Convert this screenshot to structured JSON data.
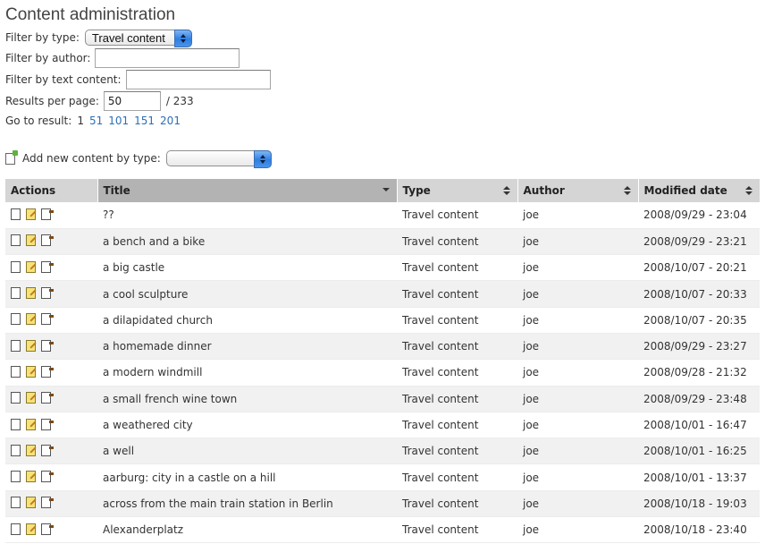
{
  "page": {
    "title": "Content administration"
  },
  "filters": {
    "type_label": "Filter by type:",
    "type_value": "Travel content",
    "author_label": "Filter by author:",
    "author_value": "",
    "text_label": "Filter by text content:",
    "text_value": ""
  },
  "results": {
    "per_page_label": "Results per page:",
    "per_page_value": "50",
    "total_text": "/ 233",
    "goto_label": "Go to result:",
    "current_page": "1",
    "pages": [
      "51",
      "101",
      "151",
      "201"
    ]
  },
  "add_new": {
    "label": "Add new content by type:",
    "value": ""
  },
  "table": {
    "headers": [
      "Actions",
      "Title",
      "Type",
      "Author",
      "Modified date"
    ],
    "rows": [
      {
        "title": "??",
        "type": "Travel content",
        "author": "joe",
        "date": "2008/09/29 - 23:04"
      },
      {
        "title": "a bench and a bike",
        "type": "Travel content",
        "author": "joe",
        "date": "2008/09/29 - 23:21"
      },
      {
        "title": "a big castle",
        "type": "Travel content",
        "author": "joe",
        "date": "2008/10/07 - 20:21"
      },
      {
        "title": "a cool sculpture",
        "type": "Travel content",
        "author": "joe",
        "date": "2008/10/07 - 20:33"
      },
      {
        "title": "a dilapidated church",
        "type": "Travel content",
        "author": "joe",
        "date": "2008/10/07 - 20:35"
      },
      {
        "title": "a homemade dinner",
        "type": "Travel content",
        "author": "joe",
        "date": "2008/09/29 - 23:27"
      },
      {
        "title": "a modern windmill",
        "type": "Travel content",
        "author": "joe",
        "date": "2008/09/28 - 21:32"
      },
      {
        "title": "a small french wine town",
        "type": "Travel content",
        "author": "joe",
        "date": "2008/09/29 - 23:48"
      },
      {
        "title": "a weathered city",
        "type": "Travel content",
        "author": "joe",
        "date": "2008/10/01 - 16:47"
      },
      {
        "title": "a well",
        "type": "Travel content",
        "author": "joe",
        "date": "2008/10/01 - 16:25"
      },
      {
        "title": "aarburg: city in a castle on a hill",
        "type": "Travel content",
        "author": "joe",
        "date": "2008/10/01 - 13:37"
      },
      {
        "title": "across from the main train station in Berlin",
        "type": "Travel content",
        "author": "joe",
        "date": "2008/10/18 - 19:03"
      },
      {
        "title": "Alexanderplatz",
        "type": "Travel content",
        "author": "joe",
        "date": "2008/10/18 - 23:40"
      }
    ]
  }
}
